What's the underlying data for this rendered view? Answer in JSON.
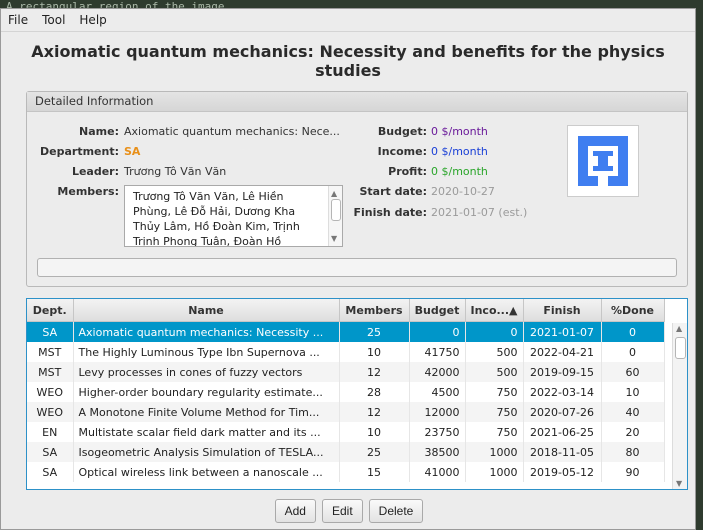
{
  "desktop_text": "A rectangular region of the image",
  "menu": [
    "File",
    "Tool",
    "Help"
  ],
  "title": "Axiomatic quantum mechanics: Necessity and benefits for the physics studies",
  "info": {
    "header": "Detailed Information",
    "name_label": "Name:",
    "name_value": "Axiomatic quantum mechanics: Nece...",
    "department_label": "Department:",
    "department_value": "SA",
    "leader_label": "Leader:",
    "leader_value": "Trương Tô Văn Văn",
    "members_label": "Members:",
    "members_value": "Trương Tô Văn Văn, Lê Hiền Phùng, Lê Đỗ Hải, Dương Kha Thủy Lâm, Hồ Đoàn Kim, Trịnh Trịnh Phong Tuân, Đoàn Hồ",
    "budget_label": "Budget:",
    "budget_value": "0 $/month",
    "income_label": "Income:",
    "income_value": "0 $/month",
    "profit_label": "Profit:",
    "profit_value": "0 $/month",
    "start_label": "Start date:",
    "start_value": "2020-10-27",
    "finish_label": "Finish date:",
    "finish_value": "2021-01-07 (est.)",
    "progress_percent": 0
  },
  "colors": {
    "department": "#e8901a",
    "budget": "#6a1b9a",
    "income": "#1a3fd6",
    "profit": "#2aa52a",
    "selected_row": "#0096c9",
    "logo": "#3f7ef0"
  },
  "table": {
    "columns": [
      "Dept.",
      "Name",
      "Members",
      "Budget",
      "Inco...▲",
      "Finish",
      "%Done"
    ],
    "rows": [
      [
        "SA",
        "Axiomatic quantum mechanics: Necessity ...",
        "25",
        "0",
        "0",
        "2021-01-07",
        "0"
      ],
      [
        "MST",
        "The Highly Luminous Type Ibn Supernova ...",
        "10",
        "41750",
        "500",
        "2022-04-21",
        "0"
      ],
      [
        "MST",
        "Levy processes in cones of fuzzy vectors",
        "12",
        "42000",
        "500",
        "2019-09-15",
        "60"
      ],
      [
        "WEO",
        "Higher-order boundary regularity estimate...",
        "28",
        "4500",
        "750",
        "2022-03-14",
        "10"
      ],
      [
        "WEO",
        "A Monotone Finite Volume Method for Tim...",
        "12",
        "12000",
        "750",
        "2020-07-26",
        "40"
      ],
      [
        "EN",
        "Multistate scalar field dark matter and its ...",
        "10",
        "23750",
        "750",
        "2021-06-25",
        "20"
      ],
      [
        "SA",
        "Isogeometric Analysis Simulation of TESLA...",
        "25",
        "38500",
        "1000",
        "2018-11-05",
        "80"
      ],
      [
        "SA",
        "Optical wireless link between a nanoscale ...",
        "15",
        "41000",
        "1000",
        "2019-05-12",
        "90"
      ]
    ]
  },
  "buttons": {
    "add": "Add",
    "edit": "Edit",
    "delete": "Delete"
  }
}
